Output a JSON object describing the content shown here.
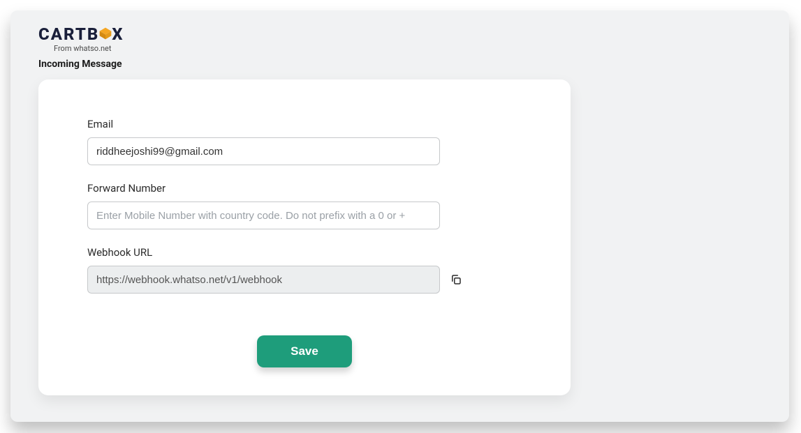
{
  "brand": {
    "name_left": "CARTB",
    "name_right": "X",
    "sub": "From whatso.net"
  },
  "page": {
    "title": "Incoming Message"
  },
  "form": {
    "email": {
      "label": "Email",
      "value": "riddheejoshi99@gmail.com"
    },
    "forward_number": {
      "label": "Forward Number",
      "placeholder": "Enter Mobile Number with country code. Do not prefix with a 0 or +",
      "value": ""
    },
    "webhook": {
      "label": "Webhook URL",
      "value": "https://webhook.whatso.net/v1/webhook"
    },
    "save_label": "Save"
  },
  "colors": {
    "accent": "#1e9d7b",
    "brand_dark": "#1a1f3a",
    "brand_icon": "#f5a623"
  }
}
